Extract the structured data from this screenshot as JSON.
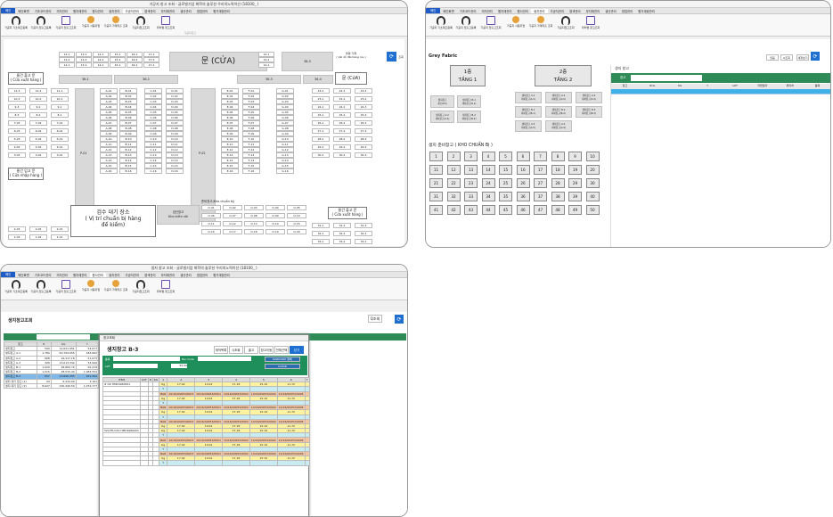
{
  "w1": {
    "title": "가공지 창고 조회 - 글로벌기업 화학의 솔루션 우리의노력이선 (18100_ )",
    "menus": [
      "메인화면",
      "기초코드관리",
      "의자관리",
      "원자재관리",
      "원사관리",
      "생지관리",
      "가공지관리",
      "염색관리",
      "부자재관리",
      "생산관리",
      "영업관리",
      "원가계정관리"
    ],
    "ribbon": [
      "가공지 기초재고등록",
      "가공지 입출고등록",
      "가공지 입출고조회",
      "가공지 사용지업",
      "가공지 가재작출 조회",
      "가공지입고조회",
      "위치별 창고조회"
    ],
    "group": "가공지창고",
    "door": "문 (CỬA)",
    "door2": "문 (CửA)",
    "unsorted": "불량 가재\n( Vải dỗ đãi hàng lưu )",
    "out1": "물건 출고 문\n( Cửa xuất hàng )",
    "in1": "물건 입고 문\n( Cửa nhập hàng )",
    "out2": "물건 출고 문\n( Cửa xuất hàng )",
    "inspect": "검수 대기 장소\n( Vị trí chuẩn bị hàng\nđể kiểm)",
    "qc": "검단창고\nKho kiểm vải",
    "ready": "준비창고(Kho chuẩn bị)",
    "topGrid": [
      "12-1",
      "13-1",
      "14-1",
      "15-1",
      "16-1",
      "17-1",
      "12-2",
      "13-2",
      "14-2",
      "15-2",
      "16-2",
      "17-2",
      "12-1",
      "13-1",
      "14-1",
      "15-1",
      "16-1",
      "17-1"
    ],
    "rowsLabel": [
      "36-1",
      "36-2",
      "36-3",
      "36-4",
      "38-3",
      "38-1",
      "38-2"
    ],
    "leftA": [
      "11-3",
      "11-2",
      "11-1",
      "10-3",
      "10-2",
      "10-1",
      "9-3",
      "9-2",
      "9-1",
      "8-3",
      "8-2",
      "8-1",
      "7-03",
      "7-02",
      "7-01",
      "6-03",
      "6-02",
      "6-01",
      "5-03",
      "5-02",
      "5-01",
      "4-03",
      "4-02",
      "4-01",
      "3-03",
      "3-02",
      "3-01"
    ],
    "leftB": [
      "2-03",
      "2-02",
      "2-01",
      "1-03",
      "1-02",
      "1-01"
    ],
    "colA": [
      "A-01",
      "A-02",
      "A-03",
      "A-04",
      "A-05",
      "A-06",
      "A-07",
      "A-08",
      "A-09",
      "A-10",
      "A-11",
      "A-12",
      "A-13",
      "A-14",
      "A-15",
      "A-16"
    ],
    "colB": [
      "B-01",
      "B-02",
      "B-03",
      "B-04",
      "B-05",
      "B-06",
      "B-07",
      "B-08",
      "B-09",
      "B-10",
      "B-11",
      "B-12",
      "B-13",
      "B-14",
      "B-15",
      "B-16"
    ],
    "colC": [
      "C-01",
      "C-02",
      "C-03",
      "C-04",
      "C-05",
      "C-06",
      "C-07",
      "C-08",
      "C-09",
      "C-10",
      "C-11",
      "C-12",
      "C-13",
      "C-14",
      "C-15",
      "C-16"
    ],
    "colD": [
      "D-01",
      "D-02",
      "D-03",
      "D-04",
      "D-05",
      "D-06",
      "D-07",
      "D-08",
      "D-09",
      "D-10",
      "D-11",
      "D-12",
      "D-13",
      "D-14",
      "D-15",
      "D-16"
    ],
    "colE": [
      "E-01",
      "E-02",
      "E-03",
      "E-04",
      "E-05",
      "E-06",
      "E-07",
      "E-08",
      "E-09",
      "E-10",
      "E-11",
      "E-12",
      "E-13",
      "E-14",
      "E-15",
      "E-16"
    ],
    "colF": [
      "F-01",
      "F-02",
      "F-03",
      "F-04",
      "F-05",
      "F-06",
      "F-07",
      "F-08",
      "F-09",
      "F-10",
      "F-11",
      "F-12",
      "F-13",
      "F-14",
      "F-15",
      "F-16"
    ],
    "colG": [
      "G-01",
      "G-02",
      "G-03",
      "G-04",
      "G-05",
      "G-06",
      "G-07",
      "G-08",
      "G-09",
      "G-10",
      "G-11",
      "G-12",
      "G-13",
      "G-14",
      "G-15",
      "G-16"
    ],
    "pLabels": [
      "P-01",
      "P-02",
      "P-03"
    ],
    "rightA": [
      "23-1",
      "22-3",
      "23-3",
      "23-1",
      "22-2",
      "23-2",
      "24-1",
      "24-2",
      "24-3",
      "25-1",
      "25-2",
      "25-3",
      "26-1",
      "26-2",
      "26-3",
      "27-1",
      "27-2",
      "27-3",
      "28-1",
      "28-2",
      "28-3",
      "29-1",
      "29-2",
      "29-3",
      "30-1",
      "30-2",
      "30-3"
    ],
    "rightB": [
      "31-1",
      "31-2",
      "31-3",
      "32-1",
      "32-2",
      "32-3",
      "33-1",
      "33-2",
      "33-3",
      "34-1",
      "34-2",
      "34-3"
    ],
    "ready1": [
      "O-01",
      "O-02",
      "O-03",
      "O-04",
      "O-05"
    ],
    "ready2": [
      "O-06",
      "O-07",
      "O-08",
      "O-09",
      "O-10"
    ],
    "ready3": [
      "O-11",
      "O-12",
      "O-13",
      "O-14",
      "O-15"
    ],
    "ready4": [
      "O-16",
      "O-17",
      "O-18",
      "O-19",
      "O-20"
    ],
    "search": "조회"
  },
  "w2": {
    "title": "Grey Fabric",
    "t1": "1층\nTẦNG 1",
    "t2": "2층\nTẦNG 2",
    "listHead": "생지 창고",
    "btns": [
      "닫음",
      "Q조회",
      "새창보기"
    ],
    "warehouse": "생지 준비창고 ( KHO CHUẨN Bị )",
    "g1": [
      "생지창고\n새로(EA)",
      "생지창고 B-1\n새치창고(8-1)",
      "생지창고 A-2\n새치창고(A-2)",
      "생지창고 B-2\n새치창고(B-2)"
    ],
    "g2": [
      "생지창고 A-1\n새치창고(A-1)",
      "생지창고 A-2\n새치창고(A-2)",
      "생지창고 A-3\n새치창고(A-3)",
      "생지창고 B-1\n새치창고(B-1)",
      "생지창고 B-2\n새치창고(B-2)",
      "생지창고 B-3\n새치창고(B-3)",
      "생지창고 A-5\n새치창고(A-5)",
      "생지창고 A-4\n새치창고(A-4)"
    ],
    "nums": [
      "1",
      "2",
      "3",
      "4",
      "5",
      "6",
      "7",
      "8",
      "9",
      "10",
      "11",
      "12",
      "13",
      "14",
      "15",
      "16",
      "17",
      "18",
      "19",
      "20",
      "21",
      "22",
      "23",
      "24",
      "25",
      "26",
      "27",
      "28",
      "29",
      "30",
      "31",
      "32",
      "33",
      "34",
      "35",
      "36",
      "37",
      "38",
      "39",
      "40",
      "41",
      "42",
      "43",
      "44",
      "45",
      "46",
      "47",
      "48",
      "49",
      "50"
    ],
    "cols": [
      "창고",
      "ROL",
      "KG",
      "Y",
      "LOT",
      "작업일자",
      "제직처",
      "품목"
    ],
    "label": "창고"
  },
  "w3": {
    "title": "생지 창고 조회 - 글로벌기업 화학의 솔루션 우리의노력이선 (18100_ )",
    "head": "생지창고조회",
    "search": "Q조회",
    "leftCols": [
      "창고",
      "R",
      "KG",
      "Y"
    ],
    "leftRows": [
      [
        "생지창고",
        "500",
        "12,621.951",
        "54,077"
      ],
      [
        "생지창고 A-1",
        "1,780",
        "50,709.055",
        "183,662"
      ],
      [
        "생지창고 A-2",
        "668",
        "16,217.18",
        "51,073"
      ],
      [
        "생지창고 A-3",
        "326",
        "13,013.344",
        "53,940"
      ],
      [
        "생지창고 B-1",
        "1,029",
        "28,864.74",
        "92,219"
      ],
      [
        "생지창고 B-2",
        "1,015",
        "28,515.44",
        "1,083,552"
      ],
      [
        "생지창고 B-3",
        "657",
        "13,896.355",
        "261,392"
      ],
      [
        "생지 대기 창고 (1)",
        "94",
        "6,244.00",
        "3,161"
      ],
      [
        "생지 대기 창고 (2)",
        "8,627",
        "230,440.54",
        "1,074,777"
      ]
    ],
    "popup": {
      "title": "창고조회",
      "head": "생지창고 B-3",
      "btns": [
        "재작목록",
        "Q조회",
        "출고",
        "창고이동",
        "전체선택",
        "닫기"
      ],
      "lbl1": "품목",
      "lbl2": "Bar Code",
      "lbl3": "LOT",
      "val3": "55.00",
      "btnS": "BARCODE 재배",
      "btnC": "CLEAR",
      "cols": [
        "ITEM",
        "LOT",
        "R",
        "KG",
        "1",
        "2",
        "3",
        "4",
        "5",
        "6",
        "7"
      ],
      "item1": "# DK HMD4960001",
      "item2": "520.FR.D19 HMD4960001",
      "rowA": [
        "Kg",
        "17.42",
        "14.02",
        "17.18",
        "15.19",
        "11.72"
      ],
      "rowB": [
        "Y",
        "",
        "",
        "",
        "",
        ""
      ],
      "rowC": [
        "BAR",
        "10/16/00053/0003",
        "10/16/00053/0001",
        "10/16/00053/0002",
        "10/16/00053/0004",
        "10/16/00053/0005"
      ],
      "n1": "1",
      "n2": "20",
      "n3": "207",
      "n4": "2",
      "n5": "37",
      "n6": "198",
      "n7": "27"
    }
  },
  "legend": {
    "home": "메인",
    "close": "종료"
  }
}
